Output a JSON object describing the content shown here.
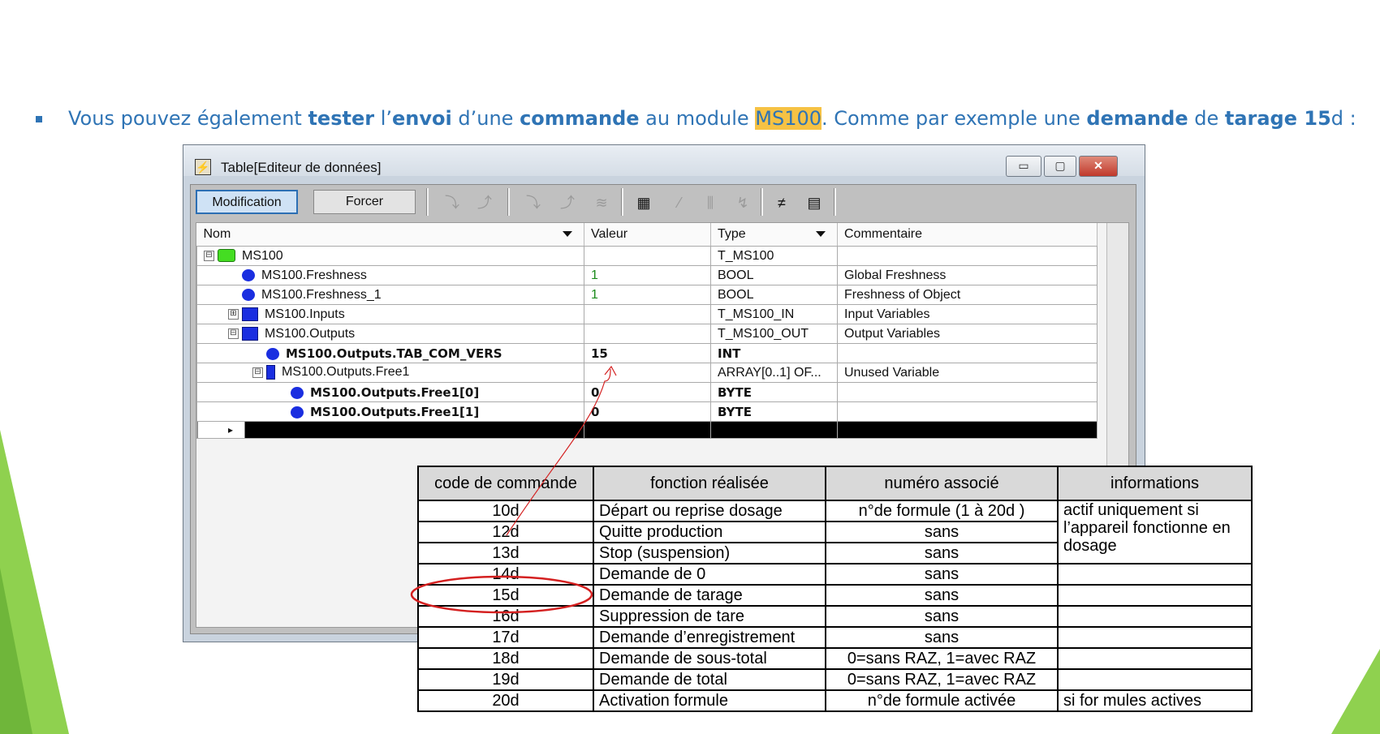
{
  "slide": {
    "bullet_parts": [
      {
        "text": "Vous pouvez également "
      },
      {
        "text": "tester",
        "bold": true
      },
      {
        "text": " l’"
      },
      {
        "text": "envoi",
        "bold": true
      },
      {
        "text": " d’une "
      },
      {
        "text": "commande",
        "bold": true
      },
      {
        "text": " au module "
      },
      {
        "text": "MS100",
        "highlight": true
      },
      {
        "text": ". Comme par exemple une "
      },
      {
        "text": "demande",
        "bold": true
      },
      {
        "text": " de "
      },
      {
        "text": "tarage 15",
        "bold": true
      },
      {
        "text": "d :"
      }
    ],
    "accent_color": "#2f74b5",
    "highlight_color": "#f6c244",
    "deco_color": "#8fd14f"
  },
  "window": {
    "title": "Table[Editeur de données]",
    "minimize": "▭",
    "maximize": "▢",
    "close": "✕",
    "toolbar": {
      "modification_label": "Modification",
      "forcer_label": "Forcer"
    },
    "grid": {
      "columns": [
        "Nom",
        "Valeur",
        "Type",
        "Commentaire"
      ],
      "rows": [
        {
          "name": "MS100",
          "value": "",
          "type": "T_MS100",
          "comment": "",
          "indent": 0,
          "icon": "green",
          "expander": "⊟"
        },
        {
          "name": "MS100.Freshness",
          "value": "1",
          "type": "BOOL",
          "comment": "Global Freshness",
          "indent": 1,
          "icon": "blue",
          "value_green": true
        },
        {
          "name": "MS100.Freshness_1",
          "value": "1",
          "type": "BOOL",
          "comment": "Freshness of Object",
          "indent": 1,
          "icon": "blue",
          "value_green": true
        },
        {
          "name": "MS100.Inputs",
          "value": "",
          "type": "T_MS100_IN",
          "comment": "Input Variables",
          "indent": 1,
          "icon": "block",
          "expander": "⊞"
        },
        {
          "name": "MS100.Outputs",
          "value": "",
          "type": "T_MS100_OUT",
          "comment": "Output Variables",
          "indent": 1,
          "icon": "block",
          "expander": "⊟"
        },
        {
          "name": "MS100.Outputs.TAB_COM_VERS",
          "value": "15",
          "type": "INT",
          "comment": "",
          "indent": 2,
          "icon": "blue",
          "bold": true
        },
        {
          "name": "MS100.Outputs.Free1",
          "value": "",
          "type": "ARRAY[0..1] OF...",
          "comment": "Unused Variable",
          "indent": 2,
          "icon": "bar",
          "expander": "⊟"
        },
        {
          "name": "MS100.Outputs.Free1[0]",
          "value": "0",
          "type": "BYTE",
          "comment": "",
          "indent": 3,
          "icon": "blue",
          "bold": true
        },
        {
          "name": "MS100.Outputs.Free1[1]",
          "value": "0",
          "type": "BYTE",
          "comment": "",
          "indent": 3,
          "icon": "blue",
          "bold": true
        }
      ],
      "new_row_marker": "▸"
    }
  },
  "command_table": {
    "headers": [
      "code de commande",
      "fonction réalisée",
      "numéro associé",
      "informations"
    ],
    "rows": [
      {
        "code": "10d",
        "fonction": "Départ ou reprise dosage",
        "numero": "n°de formule (1 à 20d )"
      },
      {
        "code": "12d",
        "fonction": "Quitte production",
        "numero": "sans"
      },
      {
        "code": "13d",
        "fonction": "Stop (suspension)",
        "numero": "sans"
      },
      {
        "code": "14d",
        "fonction": "Demande de 0",
        "numero": "sans",
        "info": ""
      },
      {
        "code": "15d",
        "fonction": "Demande de tarage",
        "numero": "sans",
        "info": "",
        "circled": true
      },
      {
        "code": "16d",
        "fonction": "Suppression de tare",
        "numero": "sans",
        "info": ""
      },
      {
        "code": "17d",
        "fonction": "Demande d’enregistrement",
        "numero": "sans",
        "info": ""
      },
      {
        "code": "18d",
        "fonction": "Demande de sous-total",
        "numero": "0=sans RAZ, 1=avec RAZ",
        "info": ""
      },
      {
        "code": "19d",
        "fonction": "Demande de total",
        "numero": "0=sans RAZ, 1=avec RAZ",
        "info": ""
      },
      {
        "code": "20d",
        "fonction": "Activation formule",
        "numero": "n°de formule activée",
        "info": "si for mules actives"
      }
    ],
    "merged_info": "actif uniquement si l’appareil fonctionne en dosage",
    "circle_color": "#d42020",
    "arrow_color": "#d42020"
  }
}
